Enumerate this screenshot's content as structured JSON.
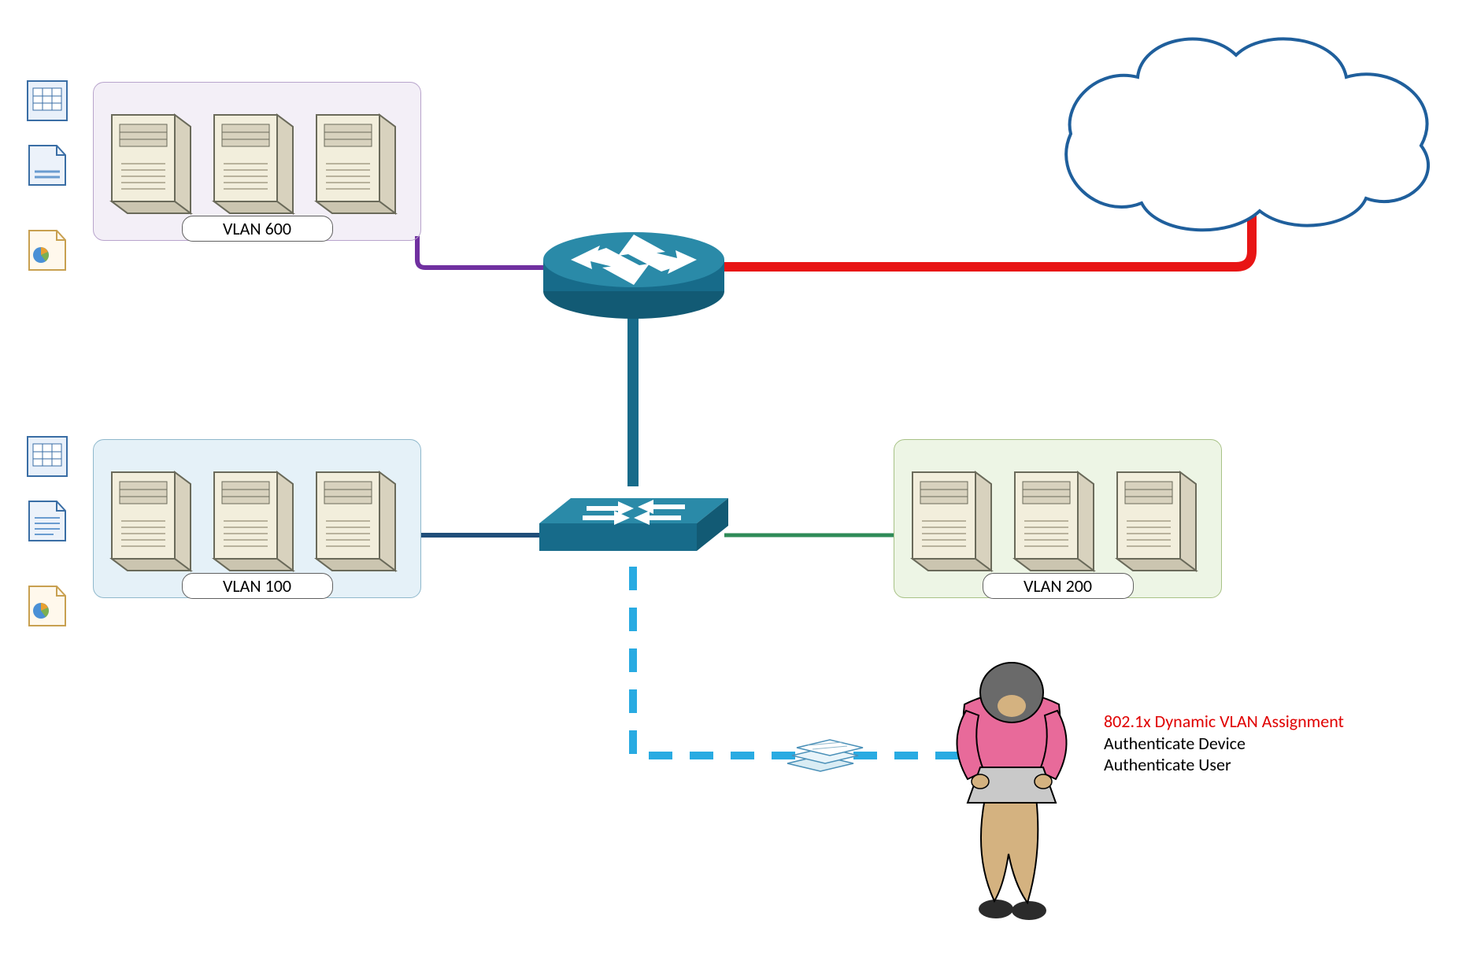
{
  "vlans": {
    "v600": {
      "label": "VLAN 600"
    },
    "v100": {
      "label": "VLAN 100"
    },
    "v200": {
      "label": "VLAN 200"
    }
  },
  "annotation": {
    "title": "802.1x Dynamic VLAN Assignment",
    "line1": "Authenticate Device",
    "line2": "Authenticate User"
  },
  "colors": {
    "router_switch": "#176b8a",
    "cloud_link": "#e81515",
    "v600_link": "#7030a0",
    "v100_link": "#1f4e79",
    "v200_link": "#2e8b57",
    "dashed_link": "#29abe2",
    "v600_bg": "rgba(112,48,160,0.08)",
    "v100_bg": "rgba(150,200,230,0.28)",
    "v200_bg": "rgba(190,220,160,0.28)",
    "cloud_stroke": "#1f5f9c"
  }
}
